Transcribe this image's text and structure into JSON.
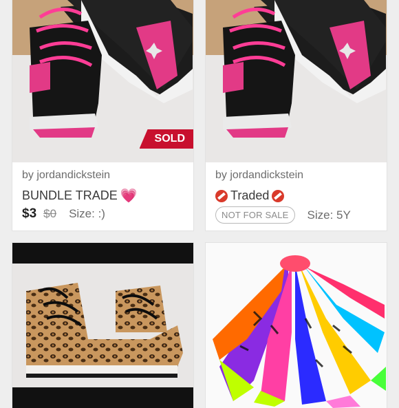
{
  "listings": [
    {
      "seller": "by jordandickstein",
      "title": "BUNDLE TRADE",
      "title_emoji": "heart-icon",
      "price": "$3",
      "original_price": "$0",
      "size": "Size: :)",
      "badge": "SOLD",
      "image": "black-pink-jordan-sneakers"
    },
    {
      "seller": "by jordandickstein",
      "title": "Traded",
      "title_emoji": "no-entry-icon",
      "status": "NOT FOR SALE",
      "size": "Size: 5Y",
      "image": "black-pink-jordan-sneakers"
    },
    {
      "image": "leopard-print-hightop-sneakers"
    },
    {
      "image": "colorful-animal-print-socks"
    }
  ],
  "colors": {
    "sold_badge": "#c8102e",
    "accent_pink": "#e8458a"
  }
}
